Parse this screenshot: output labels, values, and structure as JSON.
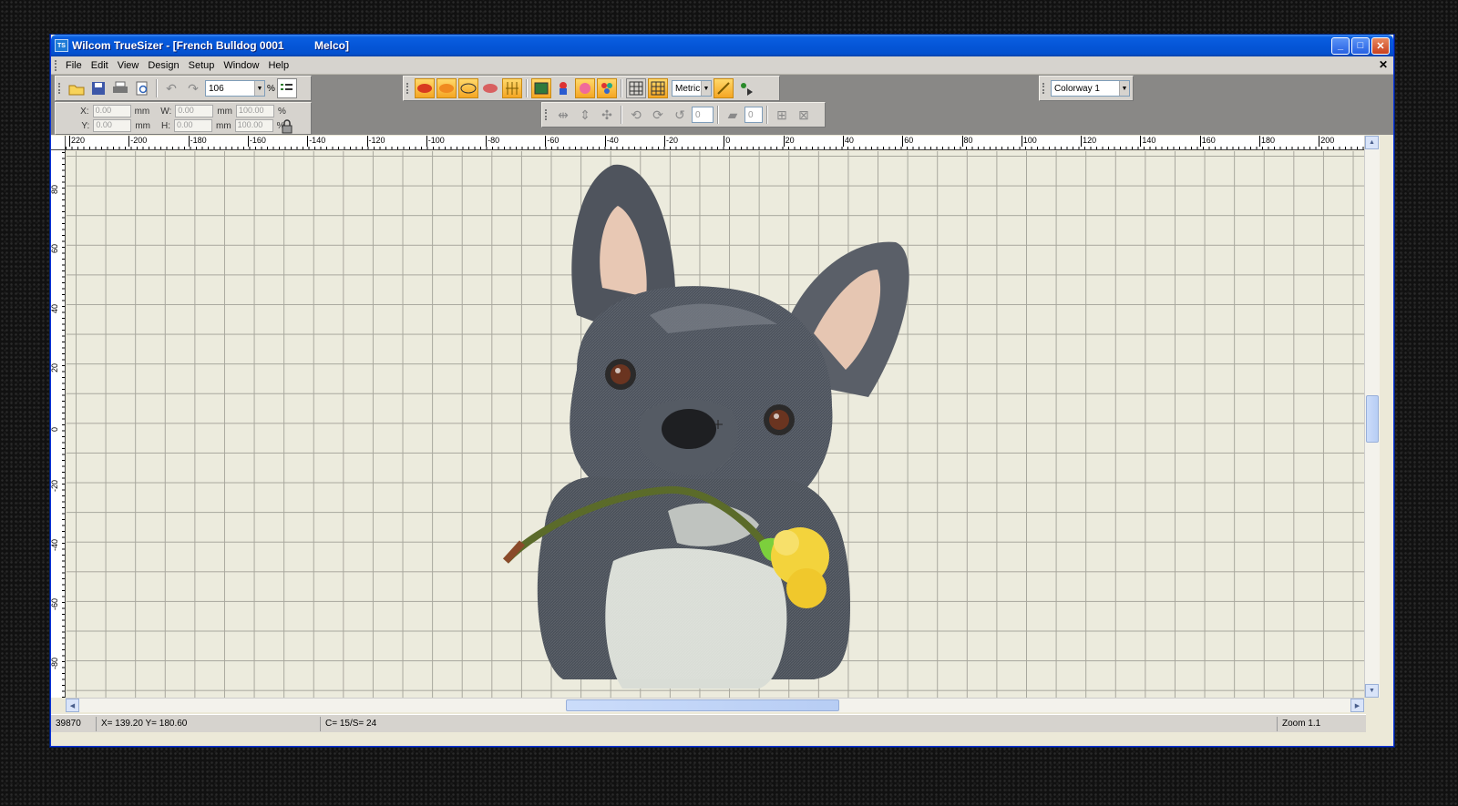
{
  "window": {
    "app_icon_text": "TS",
    "title": "Wilcom TrueSizer - [French Bulldog 0001          Melco]",
    "minimize_label": "_",
    "maximize_label": "□",
    "close_label": "✕",
    "mdi_close_label": "✕"
  },
  "menu": {
    "items": [
      "File",
      "Edit",
      "View",
      "Design",
      "Setup",
      "Window",
      "Help"
    ]
  },
  "toolbar": {
    "scale_value": "106",
    "scale_unit": "%",
    "units_select": "Metric",
    "colorway_select": "Colorway 1",
    "rotate_value": "0",
    "slant_value": "0"
  },
  "coords": {
    "x_label": "X:",
    "x_value": "0.00",
    "x_unit": "mm",
    "y_label": "Y:",
    "y_value": "0.00",
    "y_unit": "mm",
    "w_label": "W:",
    "w_value": "0.00",
    "w_unit": "mm",
    "w_pct": "100.00",
    "w_pct_unit": "%",
    "h_label": "H:",
    "h_value": "0.00",
    "h_unit": "mm",
    "h_pct": "100.00",
    "h_pct_unit": "%"
  },
  "ruler": {
    "x_ticks": [
      "220",
      "-200",
      "-180",
      "-160",
      "-140",
      "-120",
      "-100",
      "-80",
      "-60",
      "-40",
      "-20",
      "0",
      "20",
      "40",
      "60",
      "80",
      "100",
      "120",
      "140",
      "160",
      "180",
      "200"
    ],
    "y_ticks": [
      "80",
      "60",
      "40",
      "20",
      "0",
      "-20",
      "-40",
      "-60",
      "-80"
    ]
  },
  "status": {
    "stitches": "39870",
    "cursor": "X= 139.20 Y= 180.60",
    "colors": "C= 15/S= 24",
    "zoom": "Zoom 1.1"
  },
  "colors": {
    "title_bar": "#0556d8",
    "canvas_bg": "#ecebdd",
    "grid_line": "#a8a79d",
    "dog_fur": "#4c525c",
    "flower": "#f3d33c"
  }
}
